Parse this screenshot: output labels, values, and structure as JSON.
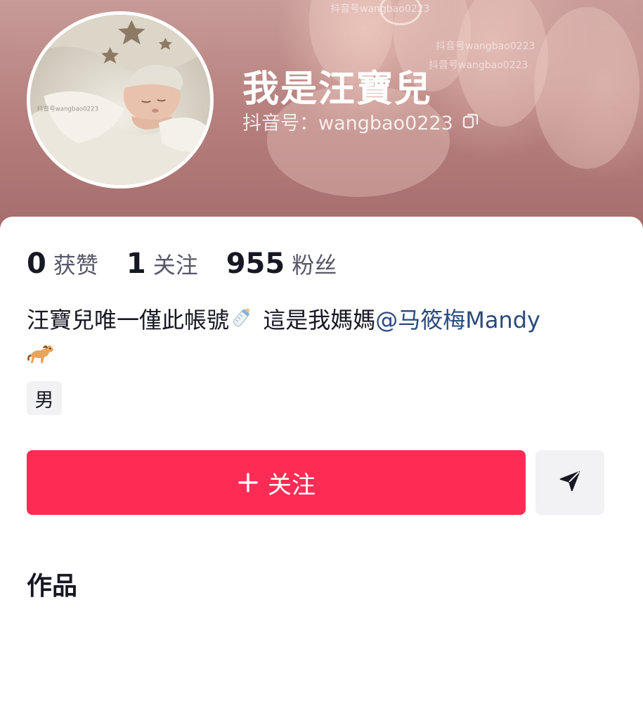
{
  "profile": {
    "nickname": "我是汪寶兒",
    "account_label": "抖音号：",
    "account_id": "wangbao0223",
    "watermark_texts": [
      "抖音号wangbao0223",
      "抖音号wangbao0223",
      "抖音号wangbao0223"
    ],
    "avatar_watermark": "抖音号wangbao0223"
  },
  "stats": [
    {
      "value": "0",
      "label": "获赞"
    },
    {
      "value": "1",
      "label": "关注"
    },
    {
      "value": "955",
      "label": "粉丝"
    }
  ],
  "bio": {
    "text": "汪寶兒唯一僅此帳號",
    "text_after_emoji": " 這是我媽媽",
    "mention": "@马筱梅Mandy",
    "emoji_1": "baby-bottle-emoji",
    "emoji_2": "horse-emoji"
  },
  "gender_tag": "男",
  "actions": {
    "follow_label": "关注",
    "follow_color": "#fe2c55",
    "send_icon": "send-icon"
  },
  "works_title": "作品",
  "icons": {
    "copy": "copy-icon",
    "plus": "plus-icon"
  }
}
